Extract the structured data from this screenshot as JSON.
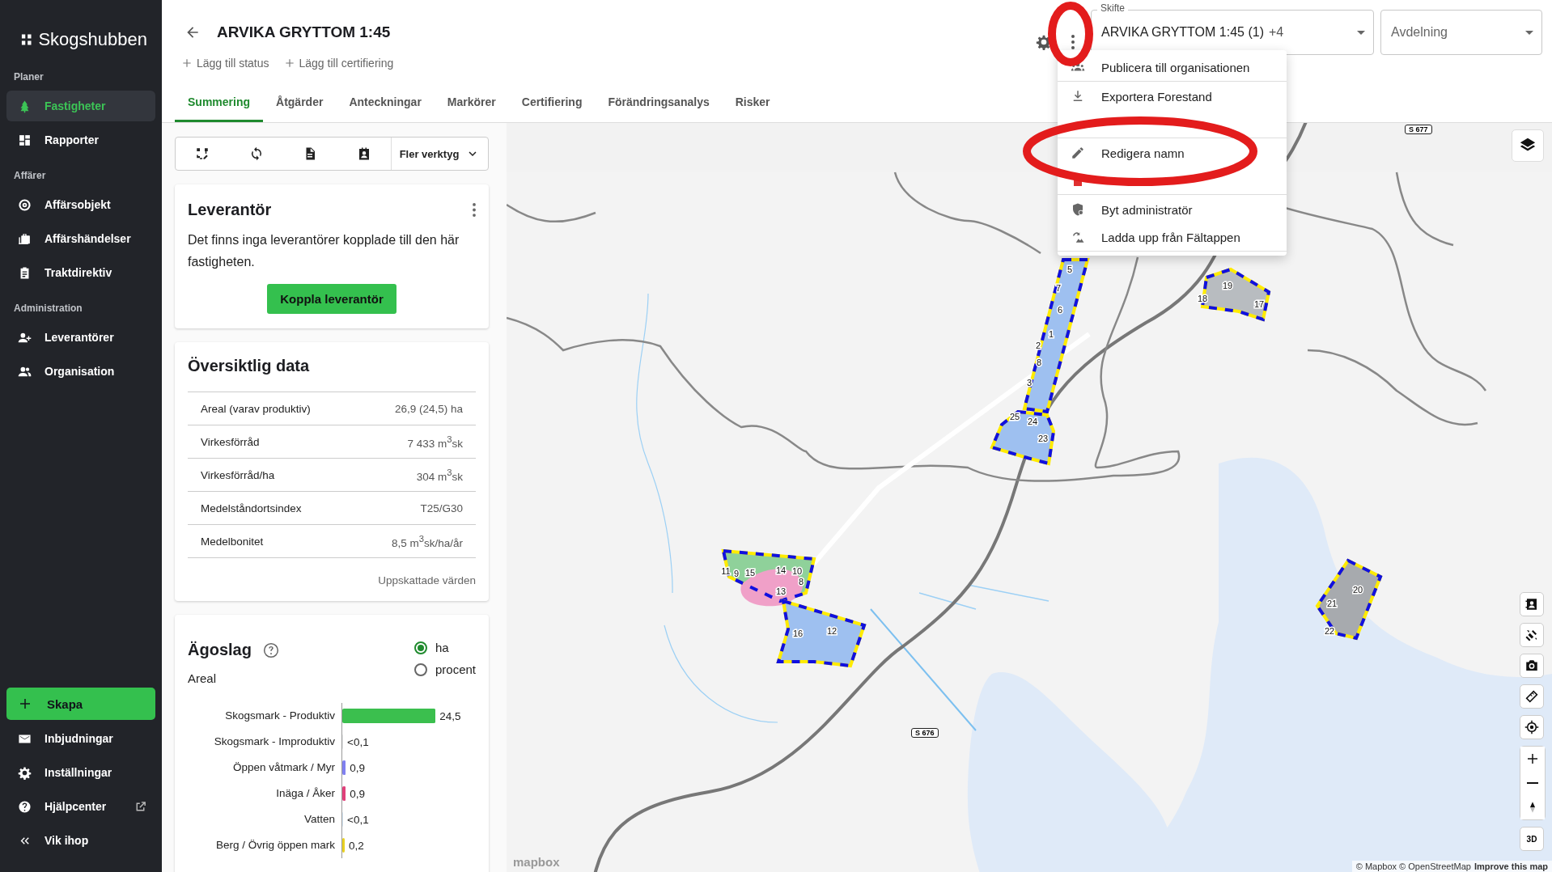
{
  "sidebar": {
    "logo": "Skogshubben",
    "sections": [
      {
        "heading": "Planer",
        "items": [
          {
            "label": "Fastigheter",
            "selected": true
          },
          {
            "label": "Rapporter",
            "selected": false
          }
        ]
      },
      {
        "heading": "Affärer",
        "items": [
          {
            "label": "Affärsobjekt",
            "selected": false
          },
          {
            "label": "Affärshändelser",
            "selected": false
          },
          {
            "label": "Traktdirektiv",
            "selected": false
          }
        ]
      },
      {
        "heading": "Administration",
        "items": [
          {
            "label": "Leverantörer",
            "selected": false
          },
          {
            "label": "Organisation",
            "selected": false
          }
        ]
      }
    ],
    "create_button": "Skapa",
    "bottom_items": [
      {
        "label": "Inbjudningar",
        "external": false
      },
      {
        "label": "Inställningar",
        "external": false
      },
      {
        "label": "Hjälpcenter",
        "external": true
      },
      {
        "label": "Vik ihop",
        "external": false
      }
    ]
  },
  "header": {
    "title": "ARVIKA GRYTTOM 1:45",
    "actions": [
      "Lägg till status",
      "Lägg till certifiering"
    ],
    "tabs": [
      {
        "label": "Summering",
        "selected": true
      },
      {
        "label": "Åtgärder",
        "selected": false
      },
      {
        "label": "Anteckningar",
        "selected": false
      },
      {
        "label": "Markörer",
        "selected": false
      },
      {
        "label": "Certifiering",
        "selected": false
      },
      {
        "label": "Förändringsanalys",
        "selected": false
      },
      {
        "label": "Risker",
        "selected": false
      }
    ]
  },
  "selectors": [
    {
      "label": "Skifte",
      "value": "ARVIKA GRYTTOM 1:45 (1)",
      "extra": "+4"
    },
    {
      "placeholder": "Avdelning"
    }
  ],
  "menu": {
    "items": [
      {
        "label": "Publicera till organisationen",
        "divider_after": true
      },
      {
        "label": "Exportera Forestand",
        "divider_after": false
      },
      {
        "divider_after": true
      },
      {
        "label": "Redigera namn",
        "divider_after": false
      },
      {
        "divider_after": true
      },
      {
        "label": "Byt administratör",
        "divider_after": false
      },
      {
        "label": "Ladda upp från Fältappen",
        "divider_after": true
      }
    ]
  },
  "toolbar": {
    "more_tools": "Fler verktyg"
  },
  "supplier_card": {
    "title": "Leverantör",
    "text": "Det finns inga leverantörer kopplade till den här fastigheten.",
    "button": "Koppla leverantör"
  },
  "overview": {
    "title": "Översiktlig data",
    "rows": [
      {
        "label": "Areal (varav produktiv)",
        "value": "26,9 (24,5) ha"
      },
      {
        "label": "Virkesförråd",
        "value": "7 433 m$^{3}$sk"
      },
      {
        "label": "Virkesförråd/ha",
        "value": "304 m$^{3}$sk"
      },
      {
        "label": "Medelståndortsindex",
        "value": "T25/G30"
      },
      {
        "label": "Medelbonitet",
        "value": "8,5 m$^{3}$sk/ha/år"
      }
    ],
    "footnote": "Uppskattade värden"
  },
  "land_use": {
    "title": "Ägoslag",
    "subtitle": "Areal",
    "units": [
      {
        "label": "ha",
        "selected": true
      },
      {
        "label": "procent",
        "selected": false
      }
    ],
    "chart_data": {
      "type": "bar",
      "orientation": "horizontal",
      "categories": [
        "Skogsmark - Produktiv",
        "Skogsmark - Improduktiv",
        "Öppen våtmark / Myr",
        "Inäga / Åker",
        "Vatten",
        "Berg / Övrig öppen mark"
      ],
      "values": [
        24.5,
        0.05,
        0.9,
        0.9,
        0.05,
        0.2
      ],
      "value_labels": [
        "24,5",
        "<0,1",
        "0,9",
        "0,9",
        "<0,1",
        "0,2"
      ],
      "colors": [
        "#3bbf4e",
        "#9aa0a6",
        "#8080f0",
        "#e0407a",
        "#5aa0e0",
        "#e8d020"
      ]
    }
  },
  "map": {
    "stand_numbers": [
      "5",
      "7",
      "6",
      "1",
      "2",
      "8",
      "3",
      "25",
      "24",
      "23",
      "19",
      "18",
      "17",
      "11",
      "9",
      "15",
      "14",
      "10",
      "8",
      "13",
      "16",
      "12",
      "21",
      "20",
      "22"
    ],
    "road_signs": [
      "S 677",
      "S 676"
    ],
    "logo": "mapbox",
    "attribution": "© Mapbox © OpenStreetMap",
    "attribution_link": "Improve this map",
    "view_toggle": "3D"
  }
}
